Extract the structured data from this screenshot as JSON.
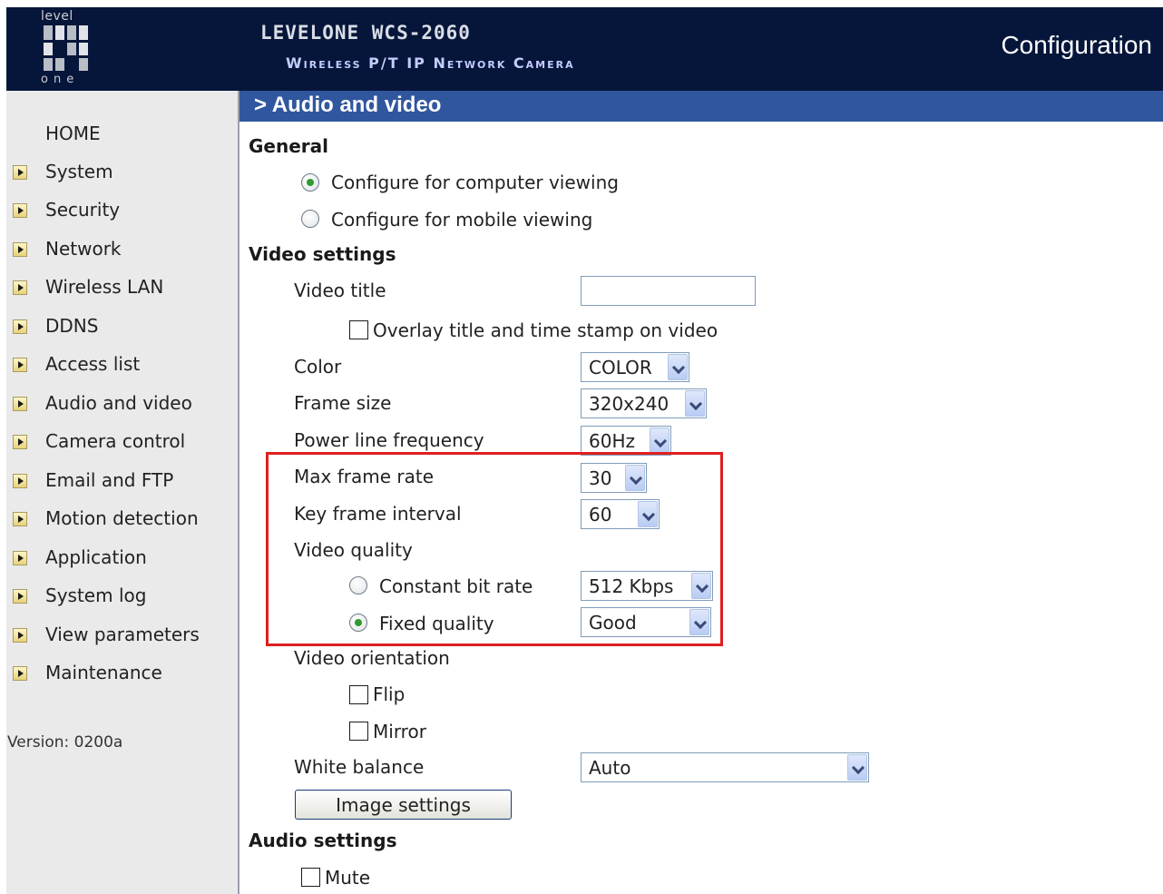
{
  "header": {
    "brand_top": "level",
    "brand_bottom": "one",
    "product_name": "LEVELONE WCS-2060",
    "product_desc": "Wireless P/T IP Network Camera",
    "title": "Configuration"
  },
  "sidebar": {
    "items": [
      {
        "label": "HOME"
      },
      {
        "label": "System"
      },
      {
        "label": "Security"
      },
      {
        "label": "Network"
      },
      {
        "label": "Wireless LAN"
      },
      {
        "label": "DDNS"
      },
      {
        "label": "Access list"
      },
      {
        "label": "Audio and video"
      },
      {
        "label": "Camera control"
      },
      {
        "label": "Email and FTP"
      },
      {
        "label": "Motion detection"
      },
      {
        "label": "Application"
      },
      {
        "label": "System log"
      },
      {
        "label": "View parameters"
      },
      {
        "label": "Maintenance"
      }
    ],
    "version": "Version: 0200a"
  },
  "main": {
    "section_title": "> Audio and video",
    "general": {
      "heading": "General",
      "computer_viewing": "Configure for computer viewing",
      "mobile_viewing": "Configure for mobile viewing",
      "selected": "computer"
    },
    "video": {
      "heading": "Video settings",
      "video_title_label": "Video title",
      "video_title_value": "",
      "overlay_label": "Overlay title and time stamp on video",
      "overlay_checked": false,
      "color_label": "Color",
      "color_value": "COLOR",
      "frame_size_label": "Frame size",
      "frame_size_value": "320x240",
      "power_line_label": "Power line frequency",
      "power_line_value": "60Hz",
      "max_frame_rate_label": "Max frame rate",
      "max_frame_rate_value": "30",
      "key_frame_label": "Key frame interval",
      "key_frame_value": "60",
      "quality_label": "Video quality",
      "cbr_label": "Constant bit rate",
      "cbr_value": "512 Kbps",
      "fixed_quality_label": "Fixed quality",
      "fixed_quality_value": "Good",
      "quality_selected": "fixed",
      "orientation_label": "Video orientation",
      "flip_label": "Flip",
      "mirror_label": "Mirror",
      "white_balance_label": "White balance",
      "white_balance_value": "Auto",
      "image_settings_button": "Image settings"
    },
    "audio": {
      "heading": "Audio settings",
      "mute_label": "Mute"
    }
  },
  "colors": {
    "header_bg": "#06163a",
    "section_bar": "#30579e",
    "sidebar_bg": "#eaeaea",
    "highlight": "#e01f1f",
    "radio_selected": "#2f9a2f"
  }
}
